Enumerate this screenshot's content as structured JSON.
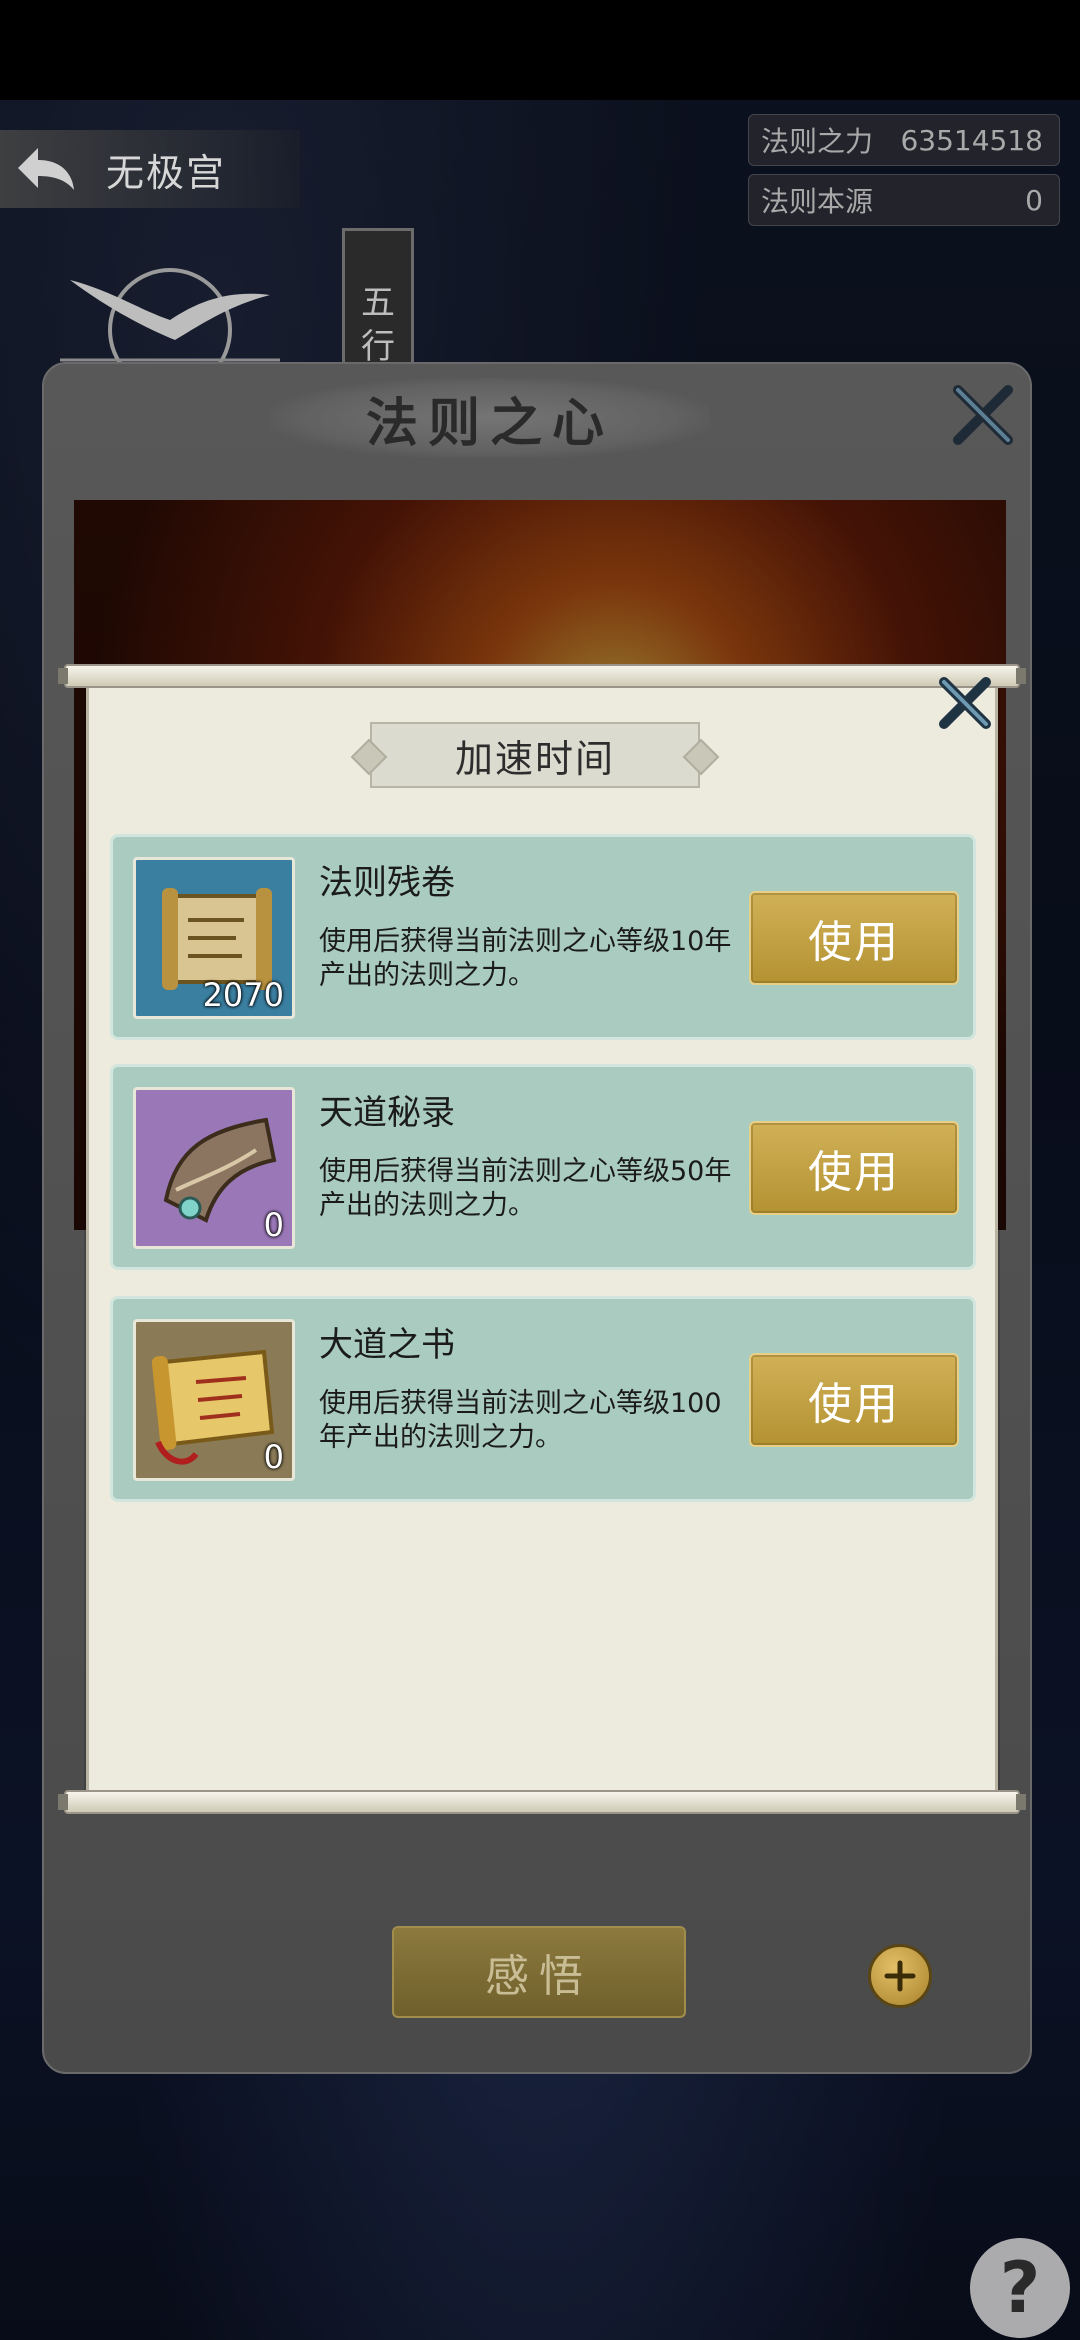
{
  "topbar": {
    "title": "无极宫",
    "resources": [
      {
        "label": "法则之力",
        "value": "63514518"
      },
      {
        "label": "法则本源",
        "value": "0"
      }
    ]
  },
  "side_tag": {
    "line1": "五",
    "line2": "行"
  },
  "main_dialog": {
    "title": "法则之心",
    "study_button": "感悟",
    "help_label": "?"
  },
  "popup": {
    "title": "加速时间",
    "items": [
      {
        "name": "法则残卷",
        "count": "2070",
        "desc": "使用后获得当前法则之心等级10年产出的法则之力。",
        "button": "使用",
        "icon": "scroll-fragment-icon",
        "icon_bg": "#3a7ea0"
      },
      {
        "name": "天道秘录",
        "count": "0",
        "desc": "使用后获得当前法则之心等级50年产出的法则之力。",
        "button": "使用",
        "icon": "secret-record-icon",
        "icon_bg": "#9a77b7"
      },
      {
        "name": "大道之书",
        "count": "0",
        "desc": "使用后获得当前法则之心等级100年产出的法则之力。",
        "button": "使用",
        "icon": "golden-scroll-icon",
        "icon_bg": "#8a7a56"
      }
    ]
  },
  "colors": {
    "card_bg": "#a9cbc0",
    "button_gold": "#c7a545",
    "paper": "#ecebde"
  }
}
